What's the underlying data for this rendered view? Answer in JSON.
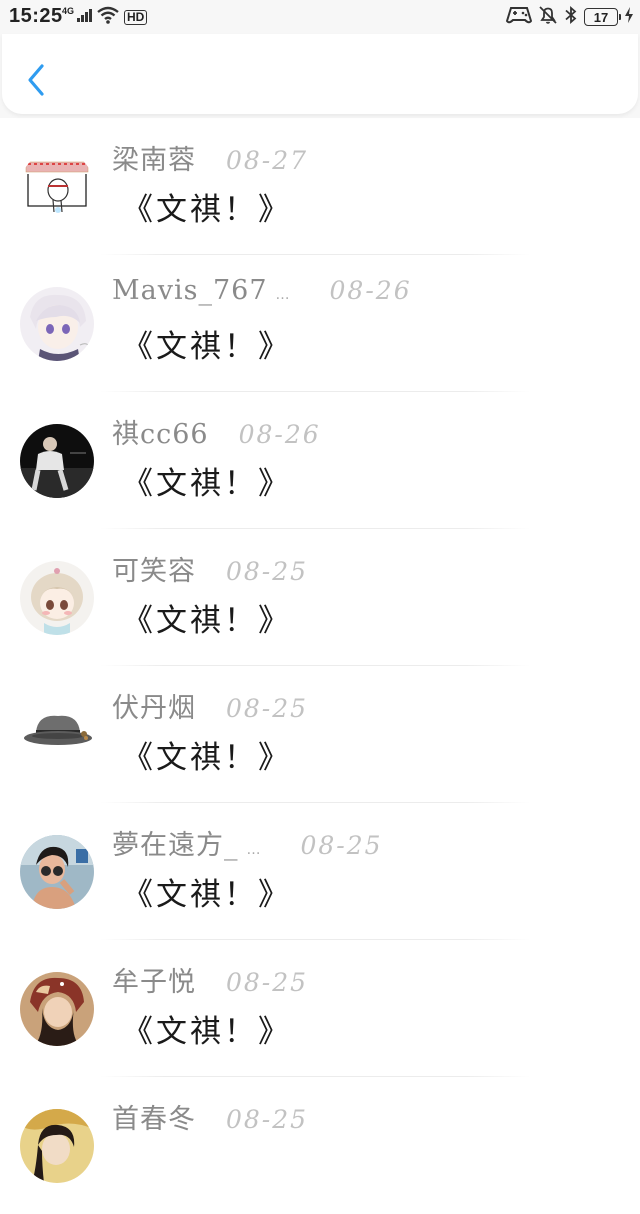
{
  "status_bar": {
    "time": "15:25",
    "network": "4G",
    "hd": "HD",
    "battery": "17"
  },
  "header": {
    "back_icon": "chevron-left-icon",
    "accent_color": "#2f9cf0"
  },
  "comments": [
    {
      "user": "梁南蓉",
      "truncated": false,
      "ellipsis": "",
      "date": "08-27",
      "text": "《文祺！》"
    },
    {
      "user": "Mavis_767",
      "truncated": true,
      "ellipsis": "…",
      "date": "08-26",
      "text": "《文祺！》"
    },
    {
      "user": "祺cc66",
      "truncated": false,
      "ellipsis": "",
      "date": "08-26",
      "text": "《文祺！》"
    },
    {
      "user": "可笑容",
      "truncated": false,
      "ellipsis": "",
      "date": "08-25",
      "text": "《文祺！》"
    },
    {
      "user": "伏丹烟",
      "truncated": false,
      "ellipsis": "",
      "date": "08-25",
      "text": "《文祺！》"
    },
    {
      "user": "夢在遠方_",
      "truncated": true,
      "ellipsis": "…",
      "date": "08-25",
      "text": "《文祺！》"
    },
    {
      "user": "牟子悦",
      "truncated": false,
      "ellipsis": "",
      "date": "08-25",
      "text": "《文祺！》"
    },
    {
      "user": "首春冬",
      "truncated": false,
      "ellipsis": "",
      "date": "08-25",
      "text": ""
    }
  ]
}
